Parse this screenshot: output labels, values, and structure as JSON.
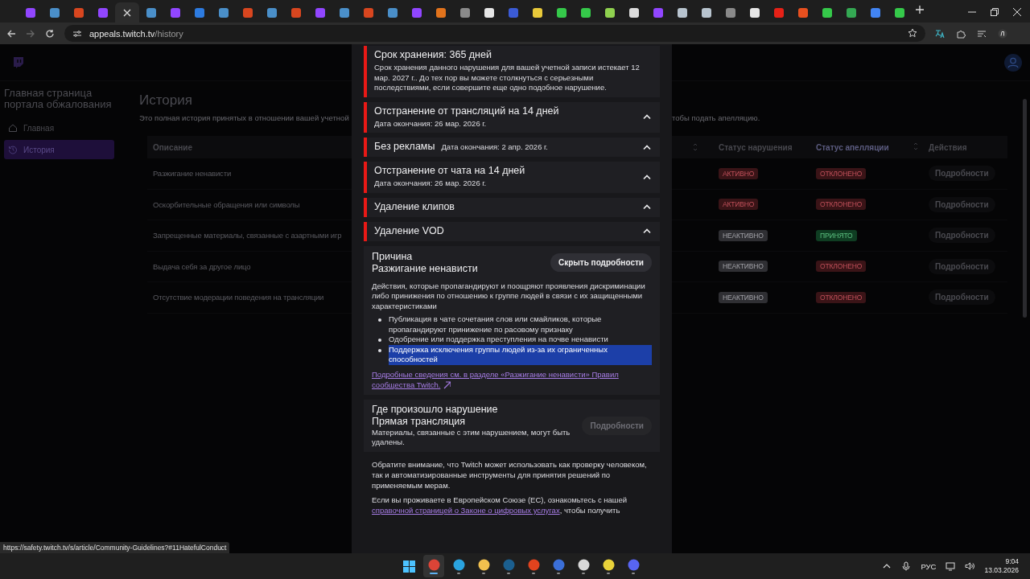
{
  "browser": {
    "tabs": [
      {
        "selected": false,
        "color": "#9146ff"
      },
      {
        "selected": false,
        "color": "#4a8fc9"
      },
      {
        "selected": false,
        "color": "#d8461f"
      },
      {
        "selected": false,
        "color": "#9146ff"
      },
      {
        "selected": true
      },
      {
        "selected": false,
        "color": "#4a8fc9"
      },
      {
        "selected": false,
        "color": "#9146ff"
      },
      {
        "selected": false,
        "color": "#2d7be0"
      },
      {
        "selected": false,
        "color": "#4a8fc9"
      },
      {
        "selected": false,
        "color": "#d8461f"
      },
      {
        "selected": false,
        "color": "#4a8fc9"
      },
      {
        "selected": false,
        "color": "#d8461f"
      },
      {
        "selected": false,
        "color": "#9146ff"
      },
      {
        "selected": false,
        "color": "#4a8fc9"
      },
      {
        "selected": false,
        "color": "#d8461f"
      },
      {
        "selected": false,
        "color": "#4a8fc9"
      },
      {
        "selected": false,
        "color": "#9146ff"
      },
      {
        "selected": false,
        "color": "#e2731c"
      },
      {
        "selected": false,
        "color": "#8a8a8a"
      },
      {
        "selected": false,
        "color": "#e6e6e6"
      },
      {
        "selected": false,
        "color": "#3b5bd6"
      },
      {
        "selected": false,
        "color": "#e8c93a"
      },
      {
        "selected": false,
        "color": "#35c94a"
      },
      {
        "selected": false,
        "color": "#35c94a"
      },
      {
        "selected": false,
        "color": "#8fd14f"
      },
      {
        "selected": false,
        "color": "#dddddd"
      },
      {
        "selected": false,
        "color": "#9146ff"
      },
      {
        "selected": false,
        "color": "#b8c4cf"
      },
      {
        "selected": false,
        "color": "#b8c4cf"
      },
      {
        "selected": false,
        "color": "#8a8a8a"
      },
      {
        "selected": false,
        "color": "#e6e6e6"
      },
      {
        "selected": false,
        "color": "#e62117"
      },
      {
        "selected": false,
        "color": "#e8501f"
      },
      {
        "selected": false,
        "color": "#35c94a"
      },
      {
        "selected": false,
        "color": "#34a853"
      },
      {
        "selected": false,
        "color": "#4285f4"
      },
      {
        "selected": false,
        "color": "#35c94a"
      }
    ],
    "address": {
      "host": "appeals.twitch.tv",
      "path": "/history"
    }
  },
  "sidebar": {
    "title": "Главная страница портала обжалования",
    "items": [
      {
        "label": "Главная",
        "kind": "home",
        "selected": false
      },
      {
        "label": "История",
        "kind": "history",
        "selected": true
      }
    ]
  },
  "heading": "История",
  "description_start": "Это полная история принятых в отношении вашей учетной",
  "description_end": "тобы подать апелляцию.",
  "table": {
    "columns": [
      "Описание",
      "Статус нарушения",
      "Статус апелляции",
      "Действия"
    ],
    "rows": [
      {
        "description": "Разжигание ненависти",
        "violation": {
          "label": "АКТИВНО",
          "kind": "active"
        },
        "appeal": {
          "label": "ОТКЛОНЕНО",
          "kind": "rejected"
        },
        "action": "Подробности"
      },
      {
        "description": "Оскорбительные обращения или символы",
        "violation": {
          "label": "АКТИВНО",
          "kind": "active"
        },
        "appeal": {
          "label": "ОТКЛОНЕНО",
          "kind": "rejected"
        },
        "action": "Подробности"
      },
      {
        "description": "Запрещенные материалы, связанные с азартными игр",
        "violation": {
          "label": "НЕАКТИВНО",
          "kind": "inactive"
        },
        "appeal": {
          "label": "ПРИНЯТО",
          "kind": "accepted"
        },
        "action": "Подробности"
      },
      {
        "description": "Выдача себя за другое лицо",
        "violation": {
          "label": "НЕАКТИВНО",
          "kind": "inactive"
        },
        "appeal": {
          "label": "ОТКЛОНЕНО",
          "kind": "rejected"
        },
        "action": "Подробности"
      },
      {
        "description": "Отсутствие модерации поведения на трансляции",
        "violation": {
          "label": "НЕАКТИВНО",
          "kind": "inactive"
        },
        "appeal": {
          "label": "ОТКЛОНЕНО",
          "kind": "rejected"
        },
        "action": "Подробности"
      }
    ]
  },
  "modal": {
    "retention": {
      "title": "Срок хранения: 365 дней",
      "text": "Срок хранения данного нарушения для вашей учетной записи истекает 12 мар. 2027 г.. До тех пор вы можете столкнуться с серьезными последствиями, если совершите еще одно подобное нарушение."
    },
    "penalties": [
      {
        "title": "Отстранение от трансляций на 14 дней",
        "end_date": "Дата окончания: 26 мар. 2026 г.",
        "kind": "stacked"
      },
      {
        "title": "Без рекламы",
        "end_date": "Дата окончания: 2 апр. 2026 г.",
        "kind": "inline"
      },
      {
        "title": "Отстранение от чата на 14 дней",
        "end_date": "Дата окончания: 26 мар. 2026 г.",
        "kind": "stacked"
      },
      {
        "title": "Удаление клипов",
        "kind": "stacked"
      },
      {
        "title": "Удаление VOD",
        "kind": "stacked"
      }
    ],
    "reason": {
      "label": "Причина",
      "value": "Разжигание ненависти",
      "button": "Скрыть подробности",
      "description": "Действия, которые пропагандируют и поощряют проявления дискриминации либо принижения по отношению к группе людей в связи с их защищенными характеристиками",
      "bullets": [
        {
          "text": "Публикация в чате сочетания слов или смайликов, которые пропагандируют принижение по расовому признаку",
          "highlighted": false
        },
        {
          "text": "Одобрение или поддержка преступления на почве ненависти",
          "highlighted": false
        },
        {
          "text": "Поддержка исключения группы людей из-за их ограниченных способностей",
          "highlighted": true
        }
      ],
      "link": "Подробные сведения см. в разделе «Разжигание ненависти» Правил сообщества Twitch."
    },
    "location": {
      "label": "Где произошло нарушение",
      "value": "Прямая трансляция",
      "text": "Материалы, связанные с этим нарушением, могут быть удалены.",
      "button": "Подробности",
      "disabled": true
    },
    "notes": [
      {
        "text": "Обратите внимание, что Twitch может использовать как проверку человеком, так и автоматизированные инструменты для принятия решений по применяемым мерам."
      },
      {
        "text": "Если вы проживаете в Европейском Союзе (ЕС), ознакомьтесь с нашей ",
        "link": "справочной страницей о Законе о цифровых услугах",
        "after": ", чтобы получить"
      }
    ]
  },
  "status_url": "https://safety.twitch.tv/s/article/Community-Guidelines?#11HatefulConduct",
  "taskbar": {
    "apps": [
      {
        "selected": true,
        "color": "#db4437"
      },
      {
        "selected": false,
        "color": "#2aa3df"
      },
      {
        "selected": false,
        "color": "#f2c14e"
      },
      {
        "selected": false,
        "color": "#1b5f8f"
      },
      {
        "selected": false,
        "color": "#e2431e"
      },
      {
        "selected": false,
        "color": "#3b6fd8"
      },
      {
        "selected": false,
        "color": "#d8d8d8"
      },
      {
        "selected": false,
        "color": "#e8d23a"
      },
      {
        "selected": false,
        "color": "#5865f2"
      }
    ],
    "language": "РУС",
    "time": "9:04",
    "date": "13.03.2026"
  }
}
